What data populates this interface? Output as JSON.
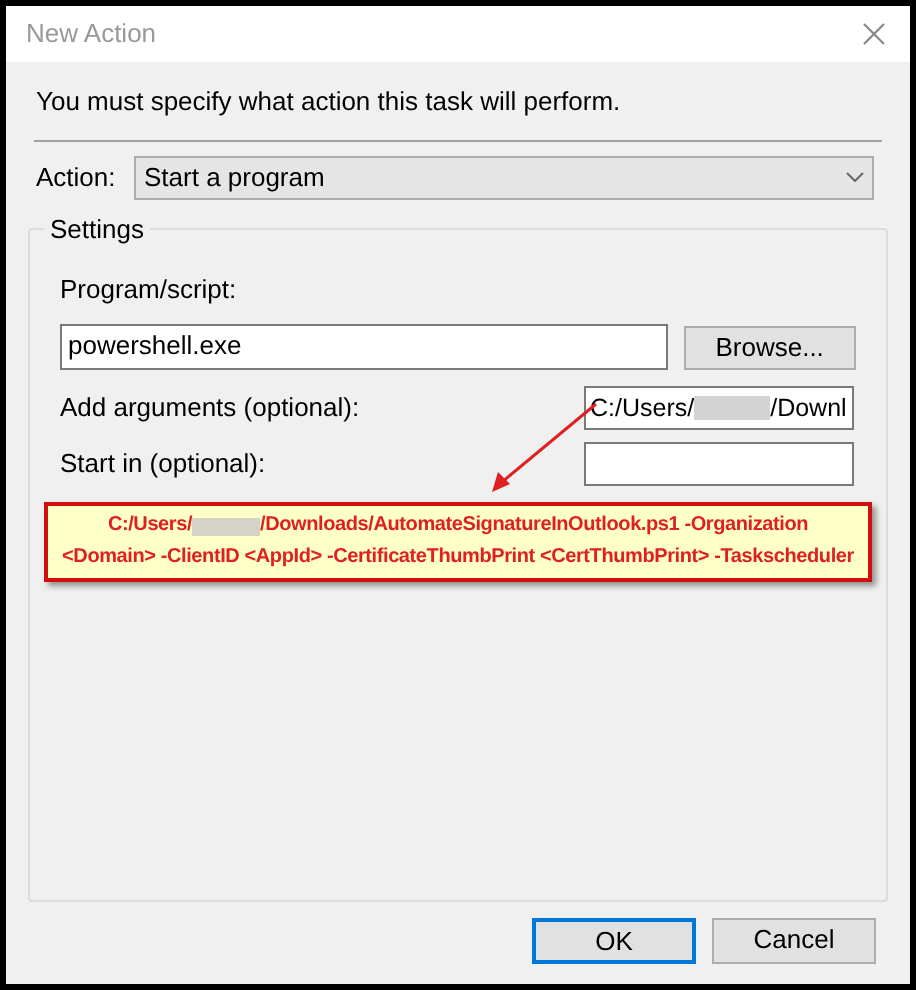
{
  "window": {
    "title": "New Action"
  },
  "instruction": "You must specify what action this task will perform.",
  "action": {
    "label": "Action:",
    "value": "Start a program"
  },
  "settings": {
    "title": "Settings",
    "program": {
      "label": "Program/script:",
      "value": "powershell.exe",
      "browse": "Browse..."
    },
    "arguments": {
      "label": "Add arguments (optional):",
      "value_parts": [
        "C:/Users/",
        "/Downl"
      ]
    },
    "start_in": {
      "label": "Start in (optional):"
    }
  },
  "callout": {
    "lines": [
      {
        "parts": [
          "C:/Users/",
          "/Downloads/AutomateSignatureInOutlook.ps1 -Organization"
        ]
      },
      {
        "parts": [
          "<Domain> -ClientID <AppId> -CertificateThumbPrint <CertThumbPrint> -Taskscheduler"
        ]
      }
    ]
  },
  "buttons": [
    {
      "label": "OK",
      "selected": true
    },
    {
      "label": "Cancel",
      "selected": false
    }
  ]
}
